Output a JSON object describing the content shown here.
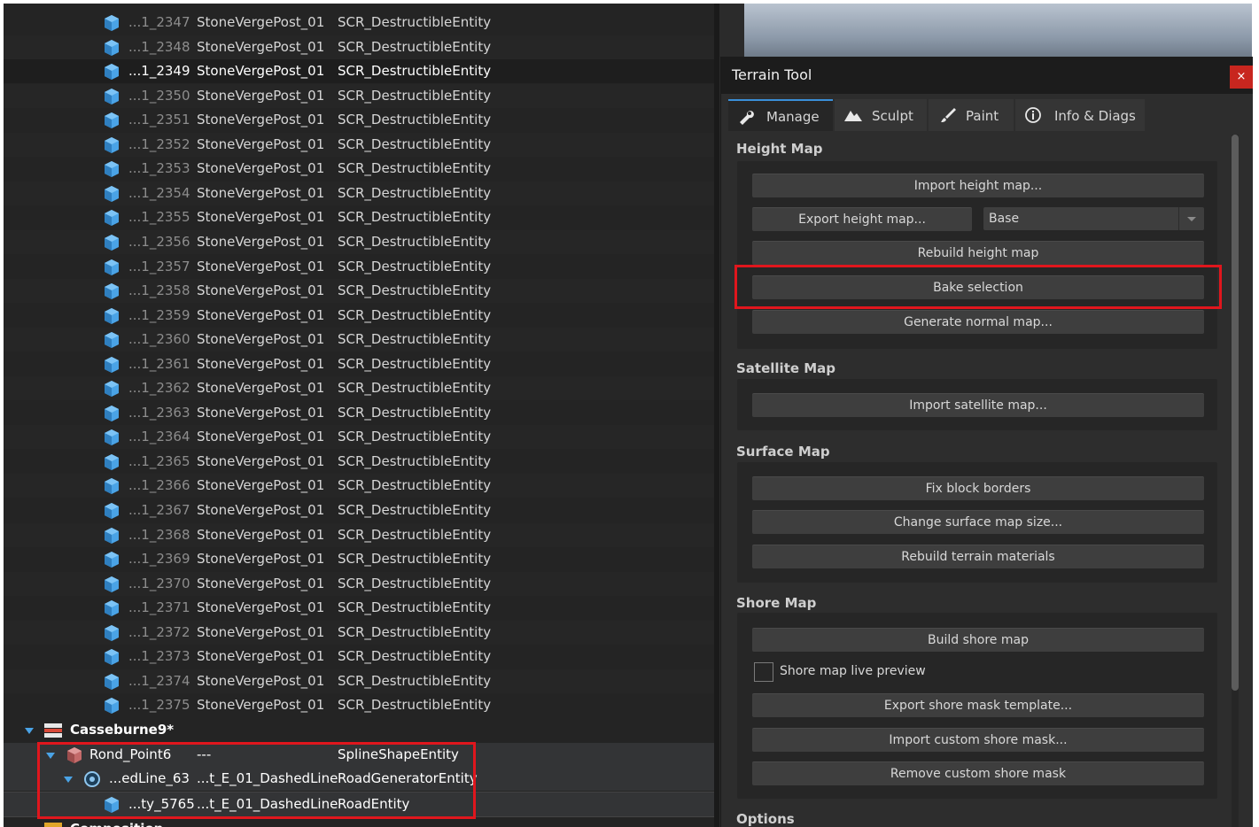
{
  "outliner": {
    "rows": [
      {
        "id": "...1_2347",
        "name": "StoneVergePost_01",
        "type": "SCR_DestructibleEntity"
      },
      {
        "id": "...1_2348",
        "name": "StoneVergePost_01",
        "type": "SCR_DestructibleEntity"
      },
      {
        "id": "...1_2349",
        "name": "StoneVergePost_01",
        "type": "SCR_DestructibleEntity"
      },
      {
        "id": "...1_2350",
        "name": "StoneVergePost_01",
        "type": "SCR_DestructibleEntity"
      },
      {
        "id": "...1_2351",
        "name": "StoneVergePost_01",
        "type": "SCR_DestructibleEntity"
      },
      {
        "id": "...1_2352",
        "name": "StoneVergePost_01",
        "type": "SCR_DestructibleEntity"
      },
      {
        "id": "...1_2353",
        "name": "StoneVergePost_01",
        "type": "SCR_DestructibleEntity"
      },
      {
        "id": "...1_2354",
        "name": "StoneVergePost_01",
        "type": "SCR_DestructibleEntity"
      },
      {
        "id": "...1_2355",
        "name": "StoneVergePost_01",
        "type": "SCR_DestructibleEntity"
      },
      {
        "id": "...1_2356",
        "name": "StoneVergePost_01",
        "type": "SCR_DestructibleEntity"
      },
      {
        "id": "...1_2357",
        "name": "StoneVergePost_01",
        "type": "SCR_DestructibleEntity"
      },
      {
        "id": "...1_2358",
        "name": "StoneVergePost_01",
        "type": "SCR_DestructibleEntity"
      },
      {
        "id": "...1_2359",
        "name": "StoneVergePost_01",
        "type": "SCR_DestructibleEntity"
      },
      {
        "id": "...1_2360",
        "name": "StoneVergePost_01",
        "type": "SCR_DestructibleEntity"
      },
      {
        "id": "...1_2361",
        "name": "StoneVergePost_01",
        "type": "SCR_DestructibleEntity"
      },
      {
        "id": "...1_2362",
        "name": "StoneVergePost_01",
        "type": "SCR_DestructibleEntity"
      },
      {
        "id": "...1_2363",
        "name": "StoneVergePost_01",
        "type": "SCR_DestructibleEntity"
      },
      {
        "id": "...1_2364",
        "name": "StoneVergePost_01",
        "type": "SCR_DestructibleEntity"
      },
      {
        "id": "...1_2365",
        "name": "StoneVergePost_01",
        "type": "SCR_DestructibleEntity"
      },
      {
        "id": "...1_2366",
        "name": "StoneVergePost_01",
        "type": "SCR_DestructibleEntity"
      },
      {
        "id": "...1_2367",
        "name": "StoneVergePost_01",
        "type": "SCR_DestructibleEntity"
      },
      {
        "id": "...1_2368",
        "name": "StoneVergePost_01",
        "type": "SCR_DestructibleEntity"
      },
      {
        "id": "...1_2369",
        "name": "StoneVergePost_01",
        "type": "SCR_DestructibleEntity"
      },
      {
        "id": "...1_2370",
        "name": "StoneVergePost_01",
        "type": "SCR_DestructibleEntity"
      },
      {
        "id": "...1_2371",
        "name": "StoneVergePost_01",
        "type": "SCR_DestructibleEntity"
      },
      {
        "id": "...1_2372",
        "name": "StoneVergePost_01",
        "type": "SCR_DestructibleEntity"
      },
      {
        "id": "...1_2373",
        "name": "StoneVergePost_01",
        "type": "SCR_DestructibleEntity"
      },
      {
        "id": "...1_2374",
        "name": "StoneVergePost_01",
        "type": "SCR_DestructibleEntity"
      },
      {
        "id": "...1_2375",
        "name": "StoneVergePost_01",
        "type": "SCR_DestructibleEntity"
      }
    ],
    "layer": {
      "name": "Casseburne9*",
      "icon": "layer-icon"
    },
    "spline_row": {
      "name": "Rond_Point6",
      "prefab": "---",
      "type": "SplineShapeEntity",
      "icon": "spline-cube-icon"
    },
    "generator_row": {
      "name": "...edLine_63",
      "prefab": "...t_E_01_DashedLine",
      "type": "RoadGeneratorEntity",
      "icon": "generator-icon"
    },
    "road_row": {
      "name": "...ty_5765",
      "prefab": "...t_E_01_DashedLine",
      "type": "RoadEntity",
      "icon": "entity-cube-icon"
    },
    "next_layer_partial": "Composition"
  },
  "terrain_tool": {
    "title": "Terrain Tool",
    "close_label": "×",
    "tabs": [
      {
        "label": "Manage",
        "icon": "wrench-icon",
        "active": true
      },
      {
        "label": "Sculpt",
        "icon": "mountain-icon",
        "active": false
      },
      {
        "label": "Paint",
        "icon": "brush-icon",
        "active": false
      },
      {
        "label": "Info & Diags",
        "icon": "info-icon",
        "active": false
      }
    ],
    "height_map": {
      "title": "Height Map",
      "import": "Import height map...",
      "export": "Export height map...",
      "export_target": "Base",
      "rebuild": "Rebuild height map",
      "bake": "Bake selection",
      "normal": "Generate normal map..."
    },
    "satellite_map": {
      "title": "Satellite Map",
      "import": "Import satellite map..."
    },
    "surface_map": {
      "title": "Surface Map",
      "fix": "Fix block borders",
      "change_size": "Change surface map size...",
      "rebuild_materials": "Rebuild terrain materials"
    },
    "shore_map": {
      "title": "Shore Map",
      "build": "Build shore map",
      "live_preview": "Shore map live preview",
      "live_preview_checked": false,
      "export_template": "Export shore mask template...",
      "import_custom": "Import custom shore mask...",
      "remove_custom": "Remove custom shore mask"
    },
    "options_title": "Options"
  },
  "colors": {
    "highlight_box": "#e0161d",
    "active_tab_accent": "#3a8fd9",
    "entity_icon": "#4aa3e6"
  }
}
